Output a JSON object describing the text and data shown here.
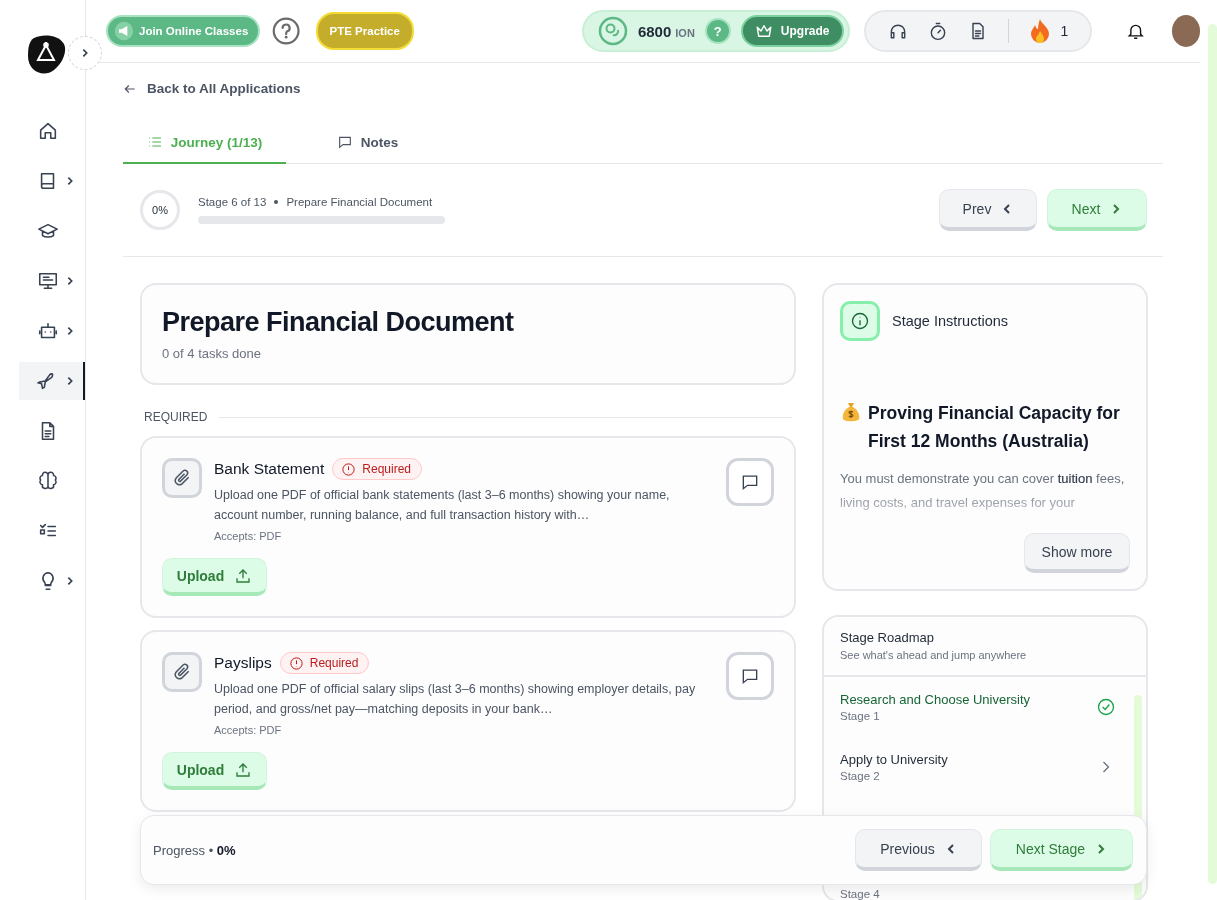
{
  "sidebar": {
    "items": [
      {
        "has_submenu": false,
        "selected": false
      },
      {
        "has_submenu": true,
        "selected": false
      },
      {
        "has_submenu": false,
        "selected": false
      },
      {
        "has_submenu": true,
        "selected": false
      },
      {
        "has_submenu": true,
        "selected": false
      },
      {
        "has_submenu": true,
        "selected": true
      },
      {
        "has_submenu": false,
        "selected": false
      },
      {
        "has_submenu": false,
        "selected": false
      },
      {
        "has_submenu": false,
        "selected": false
      },
      {
        "has_submenu": true,
        "selected": false
      }
    ]
  },
  "header": {
    "join_button": "Join Online Classes",
    "practice_button": "PTE Practice",
    "ion_amount": "6800",
    "ion_unit": "ION",
    "ion_help": "?",
    "upgrade_button": "Upgrade",
    "streak": "1"
  },
  "back_link": "Back to All Applications",
  "tabs": [
    {
      "label": "Journey (1/13)",
      "selected": true
    },
    {
      "label": "Notes",
      "selected": false
    }
  ],
  "stage": {
    "percent": "0%",
    "label": "Stage 6 of 13",
    "name": "Prepare Financial Document",
    "level": 0,
    "prev_button": "Prev",
    "next_button": "Next"
  },
  "summary": {
    "title": "Prepare Financial Document",
    "subtitle": "0 of 4 tasks done"
  },
  "section_label": "REQUIRED",
  "tasks": [
    {
      "title": "Bank Statement",
      "badge": "Required",
      "description": "Upload one PDF of official bank statements (last 3–6 months) showing your name, account number, running balance, and full transaction history with…",
      "accepts": "Accepts: PDF",
      "button": "Upload"
    },
    {
      "title": "Payslips",
      "badge": "Required",
      "description": "Upload one PDF of official salary slips (last 3–6 months) showing employer details, pay period, and gross/net pay—matching deposits in your bank…",
      "accepts": "Accepts: PDF",
      "button": "Upload"
    }
  ],
  "instructions": {
    "title": "Stage Instructions",
    "heading": "Proving Financial Capacity for First 12 Months (Australia)",
    "body": "You must demonstrate you can cover **tuition** fees, living costs, and travel expenses for your",
    "show_more": "Show more"
  },
  "roadmap": {
    "title": "Stage Roadmap",
    "subtitle": "See what's ahead and jump anywhere",
    "items": [
      {
        "title": "Research and Choose University",
        "stage": "Stage 1",
        "done": true
      },
      {
        "title": "Apply to University",
        "stage": "Stage 2",
        "done": false
      },
      {
        "stage": "Stage 4"
      }
    ]
  },
  "footer": {
    "progress_label": "Progress",
    "separator": "•",
    "progress_value": "0%",
    "previous_button": "Previous",
    "next_button": "Next Stage"
  }
}
